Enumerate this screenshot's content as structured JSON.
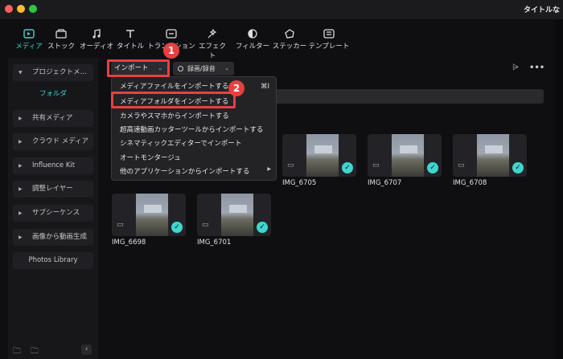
{
  "window": {
    "title": "タイトルな"
  },
  "toolbar": {
    "tabs": [
      {
        "label": "メディア",
        "icon": "media-icon",
        "active": true
      },
      {
        "label": "ストック",
        "icon": "stock-icon"
      },
      {
        "label": "オーディオ",
        "icon": "audio-icon"
      },
      {
        "label": "タイトル",
        "icon": "title-icon"
      },
      {
        "label": "トランジション",
        "icon": "transition-icon"
      },
      {
        "label": "エフェクト",
        "icon": "effect-icon"
      },
      {
        "label": "フィルター",
        "icon": "filter-icon"
      },
      {
        "label": "ステッカー",
        "icon": "sticker-icon"
      },
      {
        "label": "テンプレート",
        "icon": "template-icon"
      }
    ]
  },
  "sidebar": {
    "items": [
      {
        "label": "プロジェクトメ…",
        "expanded": true
      },
      {
        "label": "フォルダ",
        "selected": true
      },
      {
        "label": "共有メディア"
      },
      {
        "label": "クラウド メディア"
      },
      {
        "label": "Influence Kit"
      },
      {
        "label": "調整レイヤー"
      },
      {
        "label": "サブシーケンス"
      },
      {
        "label": "画像から動画生成"
      },
      {
        "label": "Photos Library"
      }
    ]
  },
  "topbar": {
    "import_label": "インポート",
    "record_label": "録画/録音"
  },
  "import_menu": {
    "items": [
      {
        "label": "メディアファイルをインポートする",
        "shortcut": "⌘I"
      },
      {
        "label": "メディアフォルダをインポートする",
        "highlighted": true
      },
      {
        "label": "カメラやスマホからインポートする"
      },
      {
        "label": "超高速動画カッターツールからインポートする"
      },
      {
        "label": "シネマティックエディターでインポート"
      },
      {
        "label": "オートモンタージュ"
      },
      {
        "label": "他のアプリケーションからインポートする",
        "submenu": true
      }
    ]
  },
  "annotations": {
    "step1": "1",
    "step2": "2"
  },
  "media": {
    "items": [
      {
        "label": "IMG_6705"
      },
      {
        "label": "IMG_6707"
      },
      {
        "label": "IMG_6708"
      },
      {
        "label": "IMG_6698"
      },
      {
        "label": "IMG_6701"
      }
    ]
  },
  "colors": {
    "accent": "#3fd6cf",
    "annotation": "#e84040"
  }
}
